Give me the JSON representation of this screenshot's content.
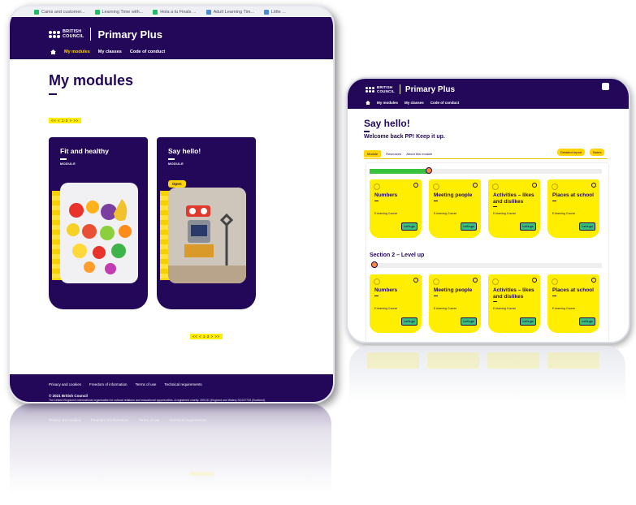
{
  "browser": {
    "tabs": [
      "Cams and customer...",
      "Learning Time with...",
      "Hola a tu Finals ...",
      "Adult Learning Tim...",
      "Little ..."
    ]
  },
  "site": {
    "brand_line1": "BRITISH",
    "brand_line2": "COUNCIL",
    "product": "Primary Plus",
    "nav": [
      "My modules",
      "My classes",
      "Code of conduct"
    ]
  },
  "modules_page": {
    "title": "My modules",
    "pager_top": "<< < 1-2 > >>",
    "pager_bottom": "<< < 1-2 > >>",
    "cards": [
      {
        "title": "Fit and healthy",
        "type": "MODULE"
      },
      {
        "title": "Say hello!",
        "type": "MODULE",
        "open_label": "Open"
      }
    ]
  },
  "footer": {
    "links": [
      "Privacy and cookies",
      "Freedom of information",
      "Terms of use",
      "Technical requirements"
    ],
    "copyright": "© 2021 British Council",
    "legal": "The United Kingdom's international organisation for cultural relations and educational opportunities. A registered charity: 209131 (England and Wales) SC037733 (Scotland)."
  },
  "module_page": {
    "title": "Say hello!",
    "welcome": "Welcome back PP! Keep it up.",
    "tabs": [
      "Module",
      "Resources",
      "About this module"
    ],
    "buttons": {
      "report": "Detailed report",
      "notes": "Notes"
    },
    "section1_progress": 0.25,
    "section2_title": "Section 2 – Level up",
    "lessons": [
      {
        "title": "Numbers",
        "type": "E-learning Course",
        "go": "Let's go"
      },
      {
        "title": "Meeting people",
        "type": "E-learning Course",
        "go": "Let's go"
      },
      {
        "title": "Activities – likes and dislikes",
        "type": "E-learning Course",
        "go": "Let's go"
      },
      {
        "title": "Places at school",
        "type": "E-learning Course",
        "go": "Let's go"
      }
    ]
  },
  "colors": {
    "brand": "#23085a",
    "accent": "#ffee00",
    "go": "#39c07a"
  }
}
